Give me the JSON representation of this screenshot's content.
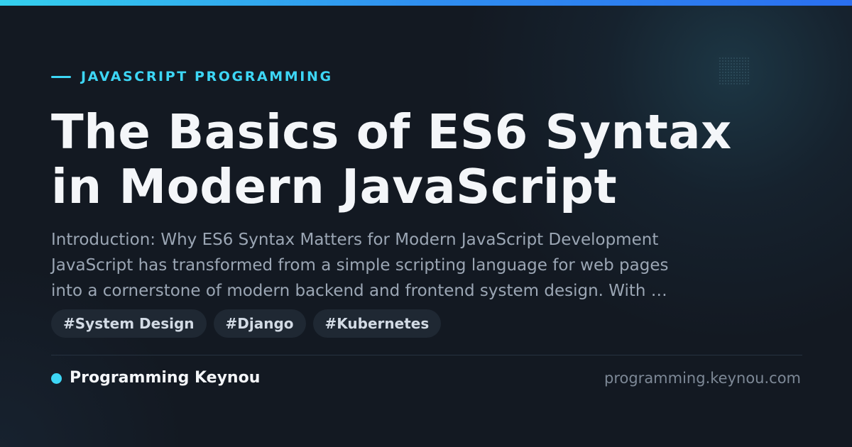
{
  "category": {
    "label": "JAVASCRIPT PROGRAMMING"
  },
  "title": {
    "line1": "The Basics of ES6 Syntax",
    "line2": "in Modern JavaScript"
  },
  "excerpt": {
    "line1": "Introduction: Why ES6 Syntax Matters for Modern JavaScript Development",
    "line2": "JavaScript has transformed from a simple scripting language for web pages",
    "line3": "into a cornerstone of modern backend and frontend system design. With …"
  },
  "tags": [
    "#System Design",
    "#Django",
    "#Kubernetes"
  ],
  "footer": {
    "brand_name": "Programming Keynou",
    "site_url": "programming.keynou.com"
  },
  "colors": {
    "accent": "#3dd6f5",
    "background": "#131922",
    "top_bar_start": "#34d0ee",
    "top_bar_end": "#2a6ff0"
  },
  "icons": {
    "category_marker": "dash-icon",
    "brand_marker": "dot-icon"
  }
}
